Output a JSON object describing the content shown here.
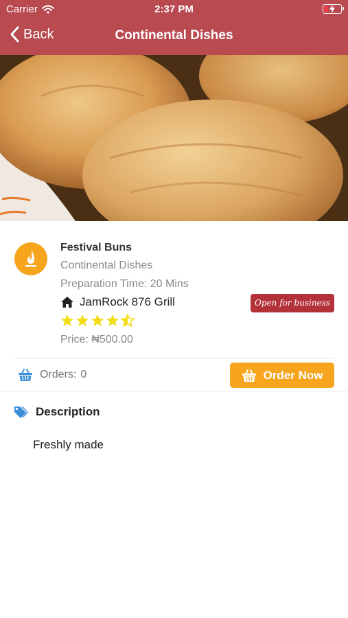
{
  "status_bar": {
    "carrier": "Carrier",
    "time": "2:37 PM"
  },
  "nav": {
    "back_label": "Back",
    "title": "Continental Dishes"
  },
  "dish": {
    "name": "Festival Buns",
    "category": "Continental Dishes",
    "preparation": "Preparation Time: 20 Mins",
    "restaurant": "JamRock 876 Grill",
    "status_badge": "Open for business",
    "rating": 4.5,
    "rating_max": 5,
    "price": "Price: ₦500.00"
  },
  "orders": {
    "label": "Orders:",
    "count": "0"
  },
  "order_button": {
    "label": "Order Now"
  },
  "description": {
    "heading": "Description",
    "text": "Freshly made"
  },
  "colors": {
    "header_bg": "#b84a50",
    "accent_orange": "#f6a51d",
    "badge_red": "#b3323a",
    "star_yellow": "#f2dc14",
    "icon_blue": "#3b8fd9"
  },
  "icons": {
    "back": "chevron-left-icon",
    "wifi": "wifi-icon",
    "battery": "battery-charging-icon",
    "logo": "flame-logo",
    "restaurant": "home-icon",
    "orders": "basket-icon",
    "order_button": "basket-icon",
    "description": "tags-icon"
  }
}
